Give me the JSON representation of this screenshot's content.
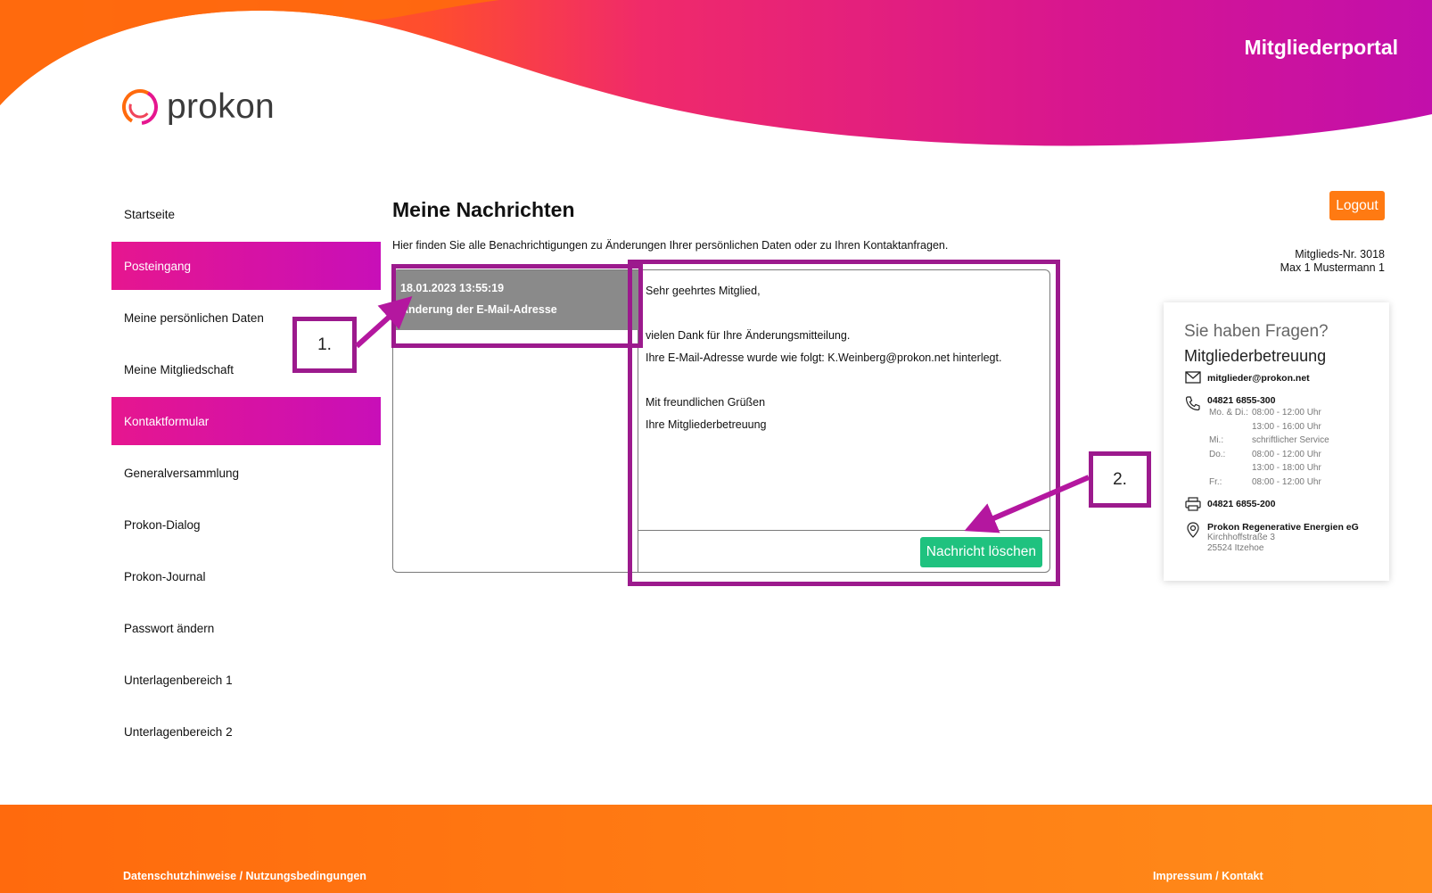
{
  "header": {
    "portal_title": "Mitgliederportal",
    "logo_text": "prokon",
    "colors": {
      "orange": "#ff6a0d",
      "magenta": "#e6168f",
      "purple": "#c80fb8"
    }
  },
  "sidebar": {
    "items": [
      {
        "label": "Startseite",
        "active": false
      },
      {
        "label": "Posteingang",
        "active": true
      },
      {
        "label": "Meine persönlichen Daten",
        "active": false
      },
      {
        "label": "Meine Mitgliedschaft",
        "active": false
      },
      {
        "label": "Kontaktformular",
        "active": true
      },
      {
        "label": "Generalversammlung",
        "active": false
      },
      {
        "label": "Prokon-Dialog",
        "active": false
      },
      {
        "label": "Prokon-Journal",
        "active": false
      },
      {
        "label": "Passwort ändern",
        "active": false
      },
      {
        "label": "Unterlagenbereich 1",
        "active": false
      },
      {
        "label": "Unterlagenbereich 2",
        "active": false
      }
    ]
  },
  "main": {
    "title": "Meine Nachrichten",
    "description": "Hier finden Sie alle Benachrichtigungen zu Änderungen Ihrer persönlichen Daten oder zu Ihren Kontaktanfragen.",
    "messages": [
      {
        "date": "18.01.2023 13:55:19",
        "subject": "Änderung der E-Mail-Adresse"
      }
    ],
    "body_lines": [
      "Sehr geehrtes Mitglied,",
      "",
      "vielen Dank für Ihre Änderungsmitteilung.",
      "Ihre E-Mail-Adresse wurde wie folgt: K.Weinberg@prokon.net hinterlegt.",
      "",
      "Mit freundlichen Grüßen",
      "Ihre Mitgliederbetreuung"
    ],
    "delete_label": "Nachricht löschen"
  },
  "annotations": {
    "label_1": "1.",
    "label_2": "2.",
    "color": "#9c1a8d"
  },
  "account": {
    "logout_label": "Logout",
    "member_nr": "Mitglieds-Nr. 3018",
    "member_name": "Max 1 Mustermann 1"
  },
  "contact": {
    "question": "Sie haben Fragen?",
    "title": "Mitgliederbetreuung",
    "email": "mitglieder@prokon.net",
    "phone": "04821 6855-300",
    "hours": [
      {
        "day": "Mo. & Di.:",
        "time": "08:00 - 12:00 Uhr"
      },
      {
        "day": "",
        "time": "13:00 - 16:00 Uhr"
      },
      {
        "day": "Mi.:",
        "time": "schriftlicher Service"
      },
      {
        "day": "Do.:",
        "time": "08:00 - 12:00 Uhr"
      },
      {
        "day": "",
        "time": "13:00 - 18:00 Uhr"
      },
      {
        "day": "Fr.:",
        "time": "08:00 - 12:00 Uhr"
      }
    ],
    "fax": "04821 6855-200",
    "company": "Prokon Regenerative Energien eG",
    "street": "Kirchhoffstraße 3",
    "city": "25524 Itzehoe"
  },
  "footer": {
    "privacy_link": "Datenschutzhinweise / Nutzungsbedingungen",
    "imprint_link": "Impressum / Kontakt"
  }
}
